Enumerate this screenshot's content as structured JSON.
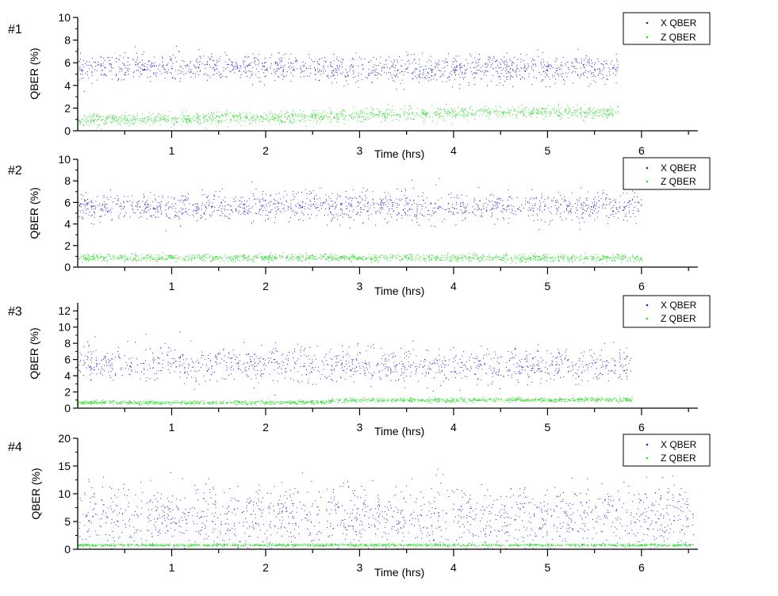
{
  "colors": {
    "x_series": "#1f1fd6",
    "z_series": "#22dd22",
    "axis": "#000000"
  },
  "chart_data": [
    {
      "type": "scatter",
      "panel_label": "#1",
      "xlabel": "Time (hrs)",
      "ylabel": "QBER (%)",
      "xlim": [
        0,
        6.6
      ],
      "ylim": [
        0,
        10
      ],
      "xticks": [
        "1",
        "2",
        "3",
        "4",
        "5",
        "6"
      ],
      "yticks": [
        "0",
        "2",
        "4",
        "6",
        "8",
        "10"
      ],
      "legend": "top-right",
      "series": [
        {
          "name": "X QBER",
          "color": "#1f1fd6",
          "duration_hrs": 5.75,
          "mean": [
            [
              0,
              5.6
            ],
            [
              1.5,
              5.6
            ],
            [
              3,
              5.4
            ],
            [
              4.5,
              5.5
            ],
            [
              5.75,
              5.5
            ]
          ],
          "spread": 0.6,
          "n_points": 1400
        },
        {
          "name": "Z QBER",
          "color": "#22dd22",
          "duration_hrs": 5.75,
          "mean": [
            [
              0,
              1.0
            ],
            [
              1.5,
              1.1
            ],
            [
              3,
              1.4
            ],
            [
              4.5,
              1.7
            ],
            [
              5.75,
              1.6
            ]
          ],
          "spread": 0.28,
          "n_points": 1400
        }
      ]
    },
    {
      "type": "scatter",
      "panel_label": "#2",
      "xlabel": "Time (hrs)",
      "ylabel": "QBER (%)",
      "xlim": [
        0,
        6.6
      ],
      "ylim": [
        0,
        10
      ],
      "xticks": [
        "1",
        "2",
        "3",
        "4",
        "5",
        "6"
      ],
      "yticks": [
        "0",
        "2",
        "4",
        "6",
        "8",
        "10"
      ],
      "legend": "top-right",
      "series": [
        {
          "name": "X QBER",
          "color": "#1f1fd6",
          "duration_hrs": 6.0,
          "mean": [
            [
              0,
              5.6
            ],
            [
              2,
              5.6
            ],
            [
              4,
              5.6
            ],
            [
              6,
              5.7
            ]
          ],
          "spread": 0.7,
          "n_points": 1400
        },
        {
          "name": "Z QBER",
          "color": "#22dd22",
          "duration_hrs": 6.0,
          "mean": [
            [
              0,
              0.9
            ],
            [
              3,
              0.9
            ],
            [
              6,
              0.85
            ]
          ],
          "spread": 0.17,
          "n_points": 1400
        }
      ]
    },
    {
      "type": "scatter",
      "panel_label": "#3",
      "xlabel": "Time (hrs)",
      "ylabel": "QBER (%)",
      "xlim": [
        0,
        6.6
      ],
      "ylim": [
        0,
        13
      ],
      "xticks": [
        "1",
        "2",
        "3",
        "4",
        "5",
        "6"
      ],
      "yticks": [
        "0",
        "2",
        "4",
        "6",
        "8",
        "10",
        "12"
      ],
      "legend": "top-right",
      "series": [
        {
          "name": "X QBER",
          "color": "#1f1fd6",
          "duration_hrs": 5.9,
          "mean": [
            [
              0,
              5.6
            ],
            [
              2,
              5.4
            ],
            [
              4,
              5.2
            ],
            [
              5.9,
              5.3
            ]
          ],
          "spread": 1.1,
          "n_points": 1200
        },
        {
          "name": "Z QBER",
          "color": "#22dd22",
          "duration_hrs": 5.9,
          "mean": [
            [
              0,
              0.7
            ],
            [
              2.65,
              0.75
            ],
            [
              2.7,
              1.0
            ],
            [
              5.9,
              1.1
            ]
          ],
          "spread": 0.13,
          "n_points": 1400
        }
      ]
    },
    {
      "type": "scatter",
      "panel_label": "#4",
      "xlabel": "Time (hrs)",
      "ylabel": "QBER (%)",
      "xlim": [
        0,
        6.6
      ],
      "ylim": [
        0,
        20
      ],
      "xticks": [
        "1",
        "2",
        "3",
        "4",
        "5",
        "6"
      ],
      "yticks": [
        "0",
        "5",
        "10",
        "15",
        "20"
      ],
      "legend": "top-right",
      "series": [
        {
          "name": "X QBER",
          "color": "#1f1fd6",
          "duration_hrs": 6.55,
          "mean": [
            [
              0,
              6.0
            ],
            [
              3,
              6.0
            ],
            [
              6.55,
              6.0
            ]
          ],
          "spread": 2.8,
          "n_points": 1500
        },
        {
          "name": "Z QBER",
          "color": "#22dd22",
          "duration_hrs": 6.55,
          "mean": [
            [
              0,
              0.8
            ],
            [
              3,
              0.8
            ],
            [
              6.55,
              0.8
            ]
          ],
          "spread": 0.12,
          "n_points": 1400
        }
      ]
    }
  ]
}
